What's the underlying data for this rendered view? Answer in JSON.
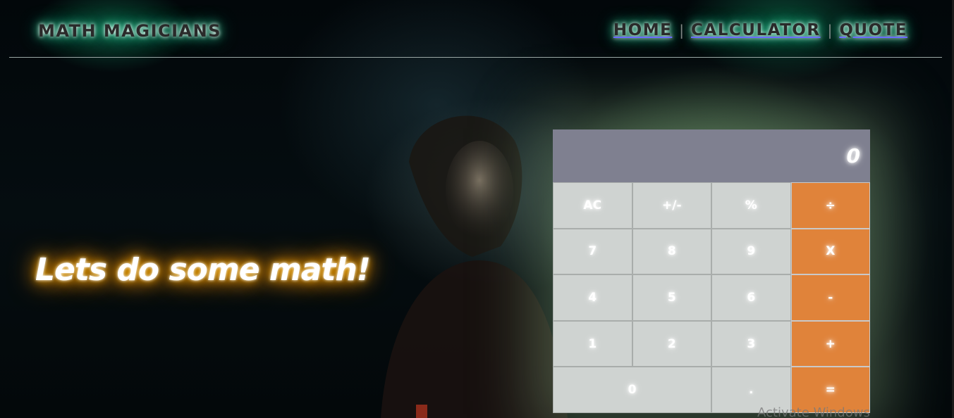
{
  "header": {
    "logo": "MATH MAGICIANS",
    "nav": [
      {
        "label": "HOME"
      },
      {
        "label": "CALCULATOR"
      },
      {
        "label": "QUOTE"
      }
    ],
    "separator": "|"
  },
  "hero": {
    "text": "Lets do some math!"
  },
  "calculator": {
    "display": "0",
    "keys": {
      "ac": "AC",
      "sign": "+/-",
      "percent": "%",
      "divide": "÷",
      "seven": "7",
      "eight": "8",
      "nine": "9",
      "multiply": "X",
      "four": "4",
      "five": "5",
      "six": "6",
      "minus": "-",
      "one": "1",
      "two": "2",
      "three": "3",
      "plus": "+",
      "zero": "0",
      "decimal": ".",
      "equals": "="
    }
  },
  "watermark": "Activate Windows",
  "colors": {
    "operator_orange": "#e0833a",
    "key_gray": "#cfd3d1",
    "display_gray": "#7f8090",
    "glow_green": "#00b478",
    "glow_orange": "#ff9800"
  }
}
